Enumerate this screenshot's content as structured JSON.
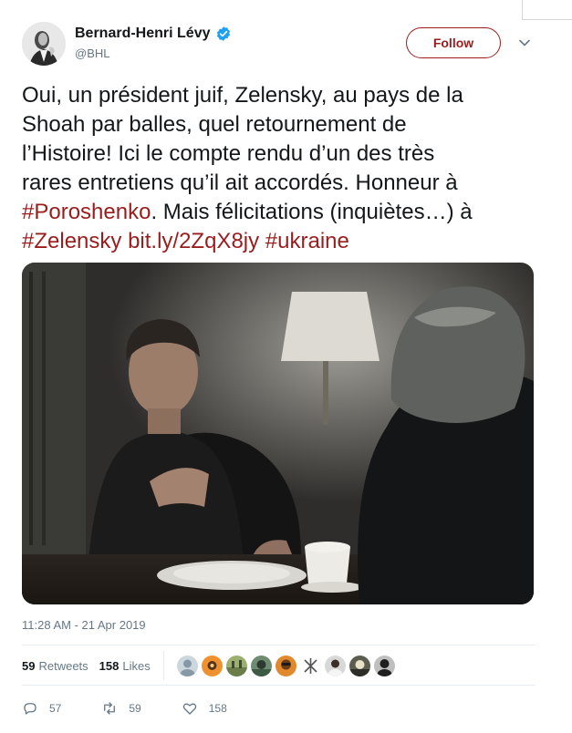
{
  "header": {
    "display_name": "Bernard-Henri Lévy",
    "handle": "@BHL",
    "follow_label": "Follow"
  },
  "tweet": {
    "text_lines": [
      "Oui, un président juif, Zelensky, au pays de la",
      "Shoah par balles, quel retournement de",
      "l’Histoire! Ici le compte rendu d’un des très",
      "rares entretiens qu’il ait accordés. Honneur à"
    ],
    "hashtag_poroshenko": "#Poroshenko",
    "line5_rest": ". Mais félicitations (inquiètes…) à",
    "hashtag_zelensky": "#Zelensky",
    "link": "bit.ly/2ZqX8jy",
    "hashtag_ukraine": "#ukraine"
  },
  "timestamp": "11:28 AM - 21 Apr 2019",
  "stats": {
    "retweets_count": "59",
    "retweets_label": "Retweets",
    "likes_count": "158",
    "likes_label": "Likes"
  },
  "actions": {
    "replies": "57",
    "retweets": "59",
    "likes": "158"
  },
  "colors": {
    "accent": "#9a1d1d",
    "muted": "#657786",
    "verified": "#1da1f2"
  }
}
